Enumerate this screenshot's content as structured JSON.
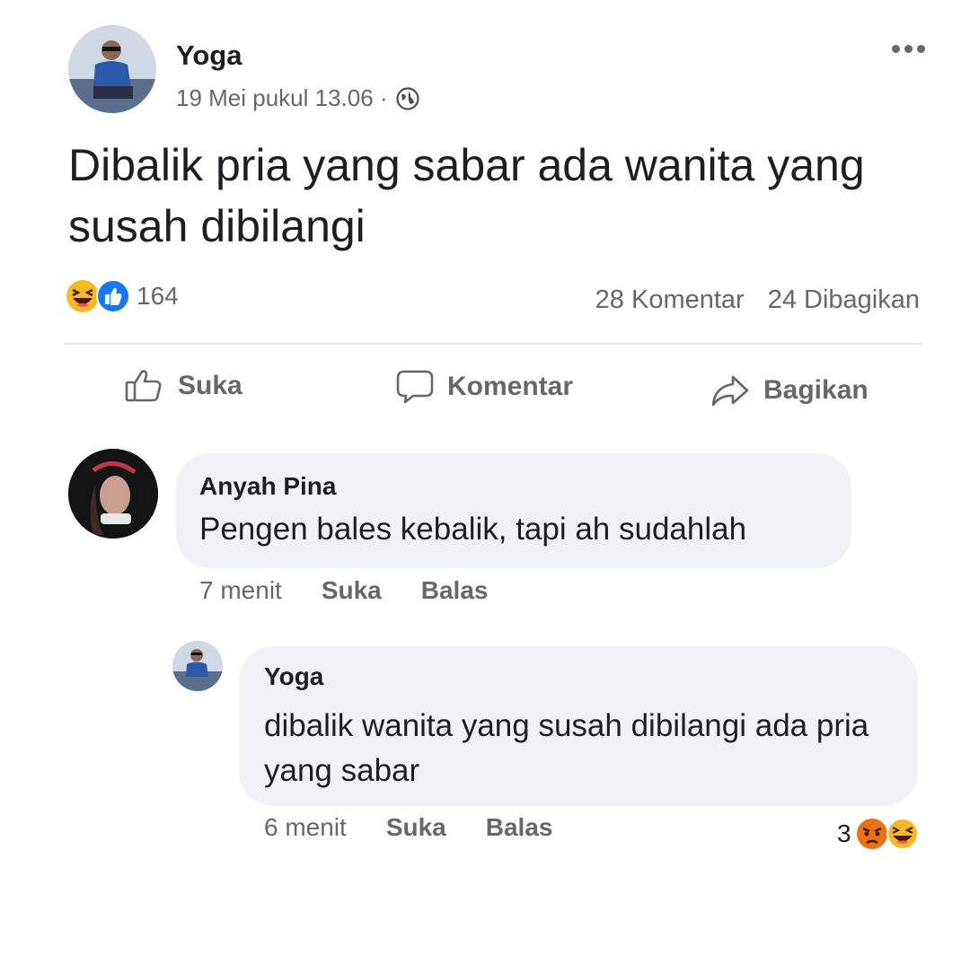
{
  "post": {
    "author": "Yoga",
    "timestamp": "19 Mei pukul 13.06 ·",
    "privacy_icon": "globe-icon",
    "text": "Dibalik pria yang sabar ada wanita yang susah dibilangi",
    "reaction_icons": [
      "laugh-reaction-icon",
      "like-reaction-icon"
    ],
    "reaction_count": "164",
    "comment_count": "28 Komentar",
    "share_count": "24 Dibagikan"
  },
  "actions": {
    "like": "Suka",
    "comment": "Komentar",
    "share": "Bagikan"
  },
  "comments": [
    {
      "author": "Anyah Pina",
      "text": "Pengen bales kebalik, tapi ah sudahlah",
      "time": "7 menit",
      "like": "Suka",
      "reply": "Balas"
    },
    {
      "author": "Yoga",
      "text": "dibalik wanita yang susah dibilangi ada pria yang sabar",
      "time": "6 menit",
      "like": "Suka",
      "reply": "Balas",
      "reaction_count": "3",
      "reaction_icons": [
        "angry-reaction-icon",
        "laugh-reaction-icon"
      ]
    }
  ],
  "colors": {
    "text": "#1c1e21",
    "secondary_text": "#65676b",
    "bubble": "#f0f2f5",
    "like_blue": "#1877f2",
    "laugh_yellow": "#f7b928",
    "angry_orange": "#e9710f"
  }
}
